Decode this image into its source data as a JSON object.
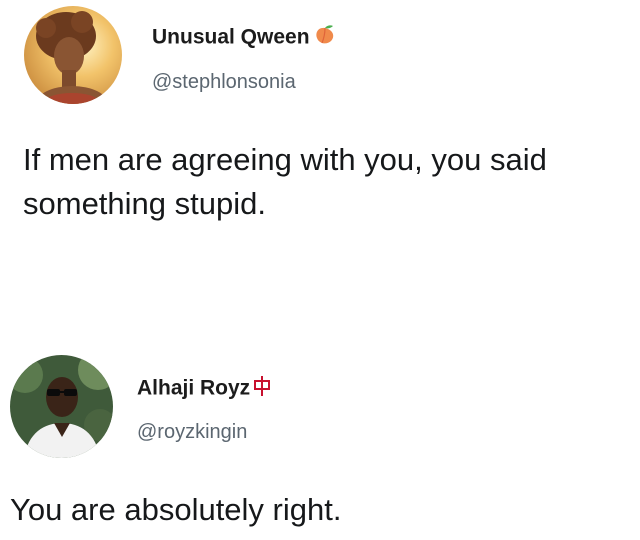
{
  "tweets": [
    {
      "display_name": "Unusual Qween",
      "name_emoji_icon": "peach-emoji-icon",
      "handle": "@stephlonsonia",
      "text": "If men are agreeing with you, you said\nsomething stupid.",
      "colors": {
        "emoji": "#f08a4b",
        "avatar_bg": "#e7b45a"
      }
    },
    {
      "display_name": "Alhaji Royz",
      "name_emoji_icon": "red-symbol-icon",
      "handle": "@royzkingin",
      "text": "You are absolutely right.",
      "colors": {
        "emoji": "#c8102e",
        "avatar_bg": "#3f5a3a"
      }
    }
  ]
}
